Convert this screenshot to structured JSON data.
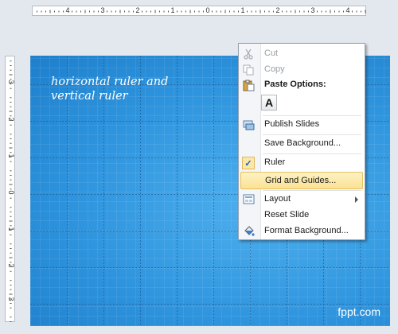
{
  "horizontal_ruler": {
    "labels": [
      "4",
      "3",
      "2",
      "1",
      "0",
      "1",
      "2",
      "3",
      "4"
    ]
  },
  "vertical_ruler": {
    "labels": [
      "3",
      "2",
      "1",
      "0",
      "1",
      "2",
      "3"
    ]
  },
  "slide": {
    "caption": "horizontal ruler and\nvertical ruler",
    "watermark": "fppt.com",
    "background_color": "#2e93dd"
  },
  "context_menu": {
    "cut": "Cut",
    "copy": "Copy",
    "paste_options_header": "Paste Options:",
    "paste_keep_text_glyph": "A",
    "publish_slides": "Publish Slides",
    "save_background": "Save Background...",
    "ruler": "Ruler",
    "ruler_checked": true,
    "grid_and_guides": "Grid and Guides...",
    "layout": "Layout",
    "reset_slide": "Reset Slide",
    "format_background": "Format Background...",
    "highlight_color": "#fbe193"
  }
}
